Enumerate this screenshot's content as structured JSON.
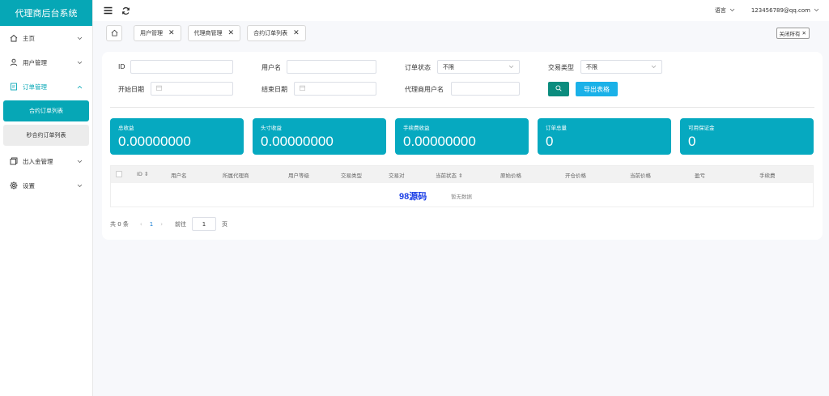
{
  "brand": {
    "title": "代理商后台系统"
  },
  "sidebar": {
    "items": [
      {
        "label": "主页",
        "icon": "home-icon"
      },
      {
        "label": "用户管理",
        "icon": "user-icon"
      },
      {
        "label": "订单管理",
        "icon": "order-icon"
      },
      {
        "label": "出入金管理",
        "icon": "money-icon"
      },
      {
        "label": "设置",
        "icon": "gear-icon"
      }
    ],
    "sub_items": [
      {
        "label": "合约订单列表"
      },
      {
        "label": "秒合约订单列表"
      }
    ]
  },
  "topbar": {
    "language": "语言",
    "user": "123456789@qq.com"
  },
  "tabs": [
    {
      "label": "用户管理"
    },
    {
      "label": "代理商管理"
    },
    {
      "label": "合约订单列表"
    }
  ],
  "close_all": "关闭所有",
  "filters": {
    "id_label": "ID",
    "username_label": "用户名",
    "order_status_label": "订单状态",
    "order_status_value": "不限",
    "trade_type_label": "交易类型",
    "trade_type_value": "不限",
    "start_date_label": "开始日期",
    "end_date_label": "结束日期",
    "agent_username_label": "代理商用户名",
    "export_label": "导出表格"
  },
  "stats": [
    {
      "label": "总收益",
      "value": "0.00000000"
    },
    {
      "label": "头寸收益",
      "value": "0.00000000"
    },
    {
      "label": "手续费收益",
      "value": "0.00000000"
    },
    {
      "label": "订单总量",
      "value": "0"
    },
    {
      "label": "可用保证金",
      "value": "0"
    }
  ],
  "table": {
    "columns": [
      "ID ⇕",
      "用户名",
      "所属代理商",
      "用户等级",
      "交易类型",
      "交易对",
      "当前状态 ⇕",
      "原始价格",
      "开仓价格",
      "当前价格",
      "盈亏",
      "手续费"
    ],
    "watermark": "98源码",
    "empty_text": "暂无数据"
  },
  "pager": {
    "total": "共 0 条",
    "prev": "‹",
    "current_page": "1",
    "next": "›",
    "goto_label": "前往",
    "goto_value": "1",
    "page_unit": "页"
  },
  "colors": {
    "accent": "#06a7b6",
    "stat_bg": "#06a9c0",
    "search_btn": "#0b8c7e",
    "export_btn": "#1ab1e8"
  }
}
